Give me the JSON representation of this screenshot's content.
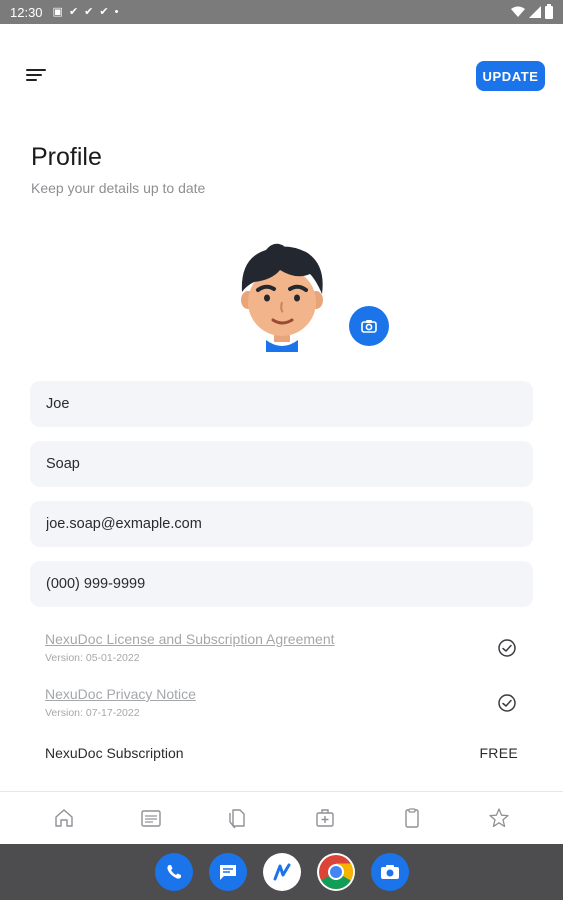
{
  "status_bar": {
    "time": "12:30",
    "icons": [
      "notification-icon",
      "check-icon",
      "check-icon",
      "check-icon",
      "dot-icon",
      "wifi-icon",
      "signal-icon",
      "battery-icon"
    ]
  },
  "header": {
    "menu_icon": "menu-icon",
    "update_label": "UPDATE"
  },
  "profile": {
    "title": "Profile",
    "subtitle": "Keep your details up to date",
    "avatar": "avatar-cartoon-man",
    "camera_icon": "camera-icon"
  },
  "form": {
    "first_name": "Joe",
    "last_name": "Soap",
    "email": "joe.soap@exmaple.com",
    "phone": "(000) 999-9999"
  },
  "documents": [
    {
      "title": "NexuDoc License and Subscription Agreement",
      "version": "Version: 05-01-2022",
      "status_icon": "check-circle-icon"
    },
    {
      "title": "NexuDoc Privacy Notice",
      "version": "Version: 07-17-2022",
      "status_icon": "check-circle-icon"
    }
  ],
  "subscription": {
    "label": "NexuDoc Subscription",
    "value": "FREE"
  },
  "bottom_nav": [
    "home-icon",
    "calendar-icon",
    "documents-icon",
    "medical-kit-icon",
    "clipboard-icon",
    "star-icon"
  ],
  "dock": [
    "phone-app-icon",
    "messages-app-icon",
    "nexudoc-app-icon",
    "chrome-app-icon",
    "camera-app-icon"
  ],
  "colors": {
    "accent": "#1b74e9",
    "field_bg": "#f3f5f9",
    "muted_text": "#a5a7ab",
    "status_bar": "#7b7b7b",
    "system_nav": "#4d4d4f"
  }
}
